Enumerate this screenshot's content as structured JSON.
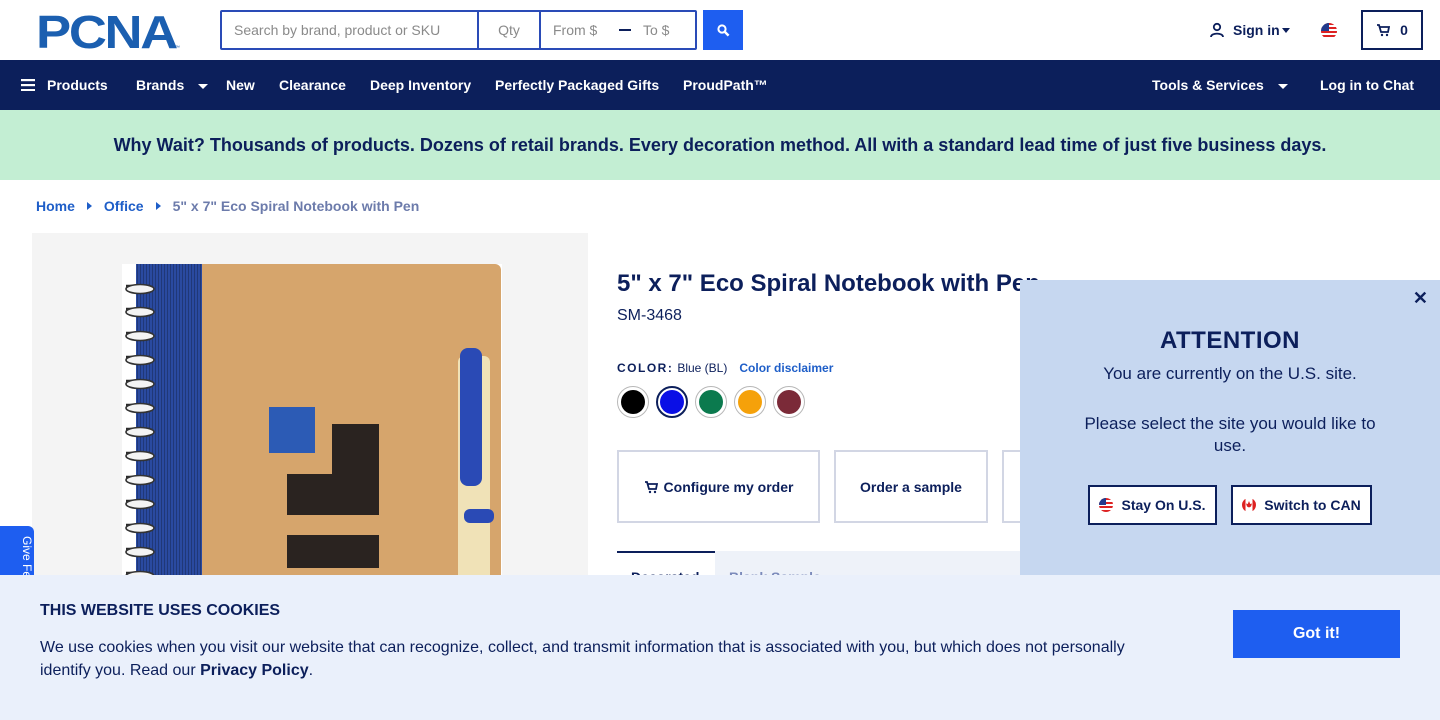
{
  "header": {
    "logo_text": "PCNA",
    "search": {
      "placeholder": "Search by brand, product or SKU",
      "value": ""
    },
    "qty": {
      "placeholder": "Qty",
      "value": ""
    },
    "price_from": {
      "placeholder": "From $",
      "value": ""
    },
    "price_to": {
      "placeholder": "To $",
      "value": ""
    },
    "search_button_icon": "search-icon",
    "sign_in_label": "Sign in",
    "locale_flag": "us-flag-icon",
    "cart_count": "0"
  },
  "nav": {
    "products": "Products",
    "brands": "Brands",
    "new": "New",
    "clearance": "Clearance",
    "deep_inventory": "Deep Inventory",
    "perfectly_packaged": "Perfectly Packaged Gifts",
    "proudpath": "ProudPath™",
    "tools_services": "Tools & Services",
    "chat": "Log in to Chat"
  },
  "promo": {
    "text": "Why Wait? Thousands of products. Dozens of retail brands. Every decoration method. All with a standard lead time of just five business days."
  },
  "breadcrumb": {
    "home": "Home",
    "office": "Office",
    "current": "5\" x 7\" Eco Spiral Notebook with Pen"
  },
  "product": {
    "title": "5\" x 7\" Eco Spiral Notebook with Pen",
    "sku": "SM-3468",
    "color_label": "COLOR:",
    "color_value": "Blue (BL)",
    "color_disclaimer": "Color disclaimer",
    "swatches": [
      {
        "name": "Black",
        "hex": "#000000",
        "selected": false
      },
      {
        "name": "Blue",
        "hex": "#0a0fe6",
        "selected": true
      },
      {
        "name": "Green",
        "hex": "#0b7a4e",
        "selected": false
      },
      {
        "name": "Orange",
        "hex": "#f5a10a",
        "selected": false
      },
      {
        "name": "Burgundy",
        "hex": "#7b2a38",
        "selected": false
      }
    ],
    "configure_label": "Configure my order",
    "sample_label": "Order a sample",
    "tab_active": "Decorated",
    "tab_other": "Blank   Sample"
  },
  "feedback_tab": "Give Fe",
  "attention": {
    "heading": "ATTENTION",
    "message1": "You are currently on the U.S. site.",
    "message2": "Please select the site you would like to use.",
    "stay_label": "Stay On U.S.",
    "switch_label": "Switch to CAN"
  },
  "cookie": {
    "heading": "THIS WEBSITE USES COOKIES",
    "text_before": "We use cookies when you visit our website that can recognize, collect, and transmit information that is associated with you, but which does not personally identify you. Read our ",
    "link": "Privacy Policy",
    "text_after": ".",
    "button": "Got it!"
  },
  "colors": {
    "navy": "#0c1f5b",
    "accent_blue": "#1e5ef0",
    "promo_green": "#c3eed3",
    "attention_bg": "#c6d7f0",
    "cookie_bg": "#eaf0fb"
  }
}
